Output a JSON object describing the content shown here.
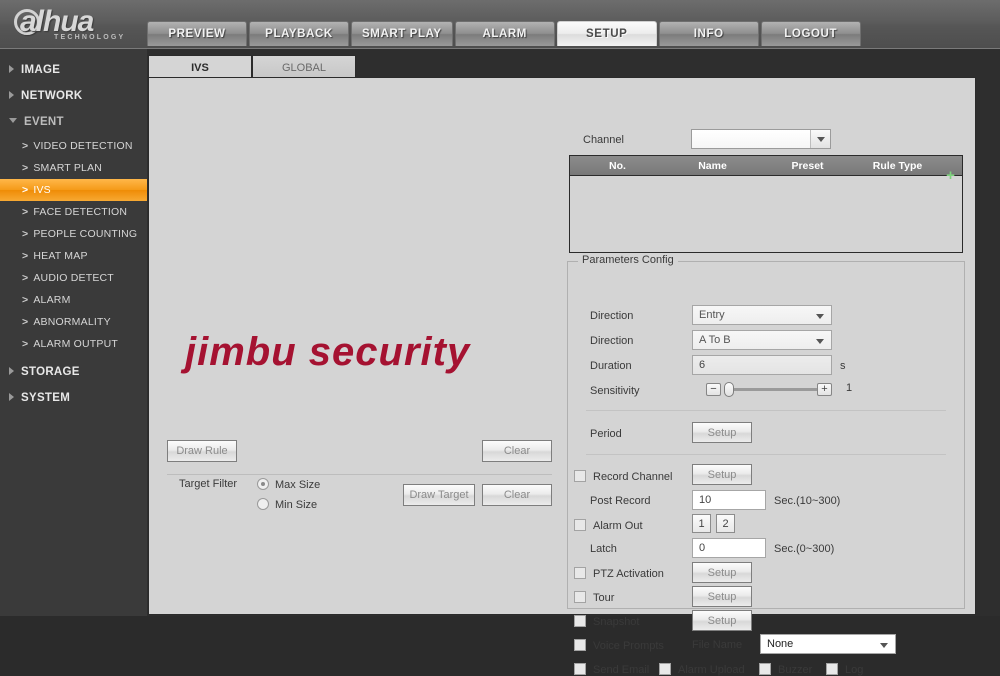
{
  "brand": {
    "name": "alhua",
    "tagline": "TECHNOLOGY"
  },
  "topnav": [
    {
      "label": "PREVIEW",
      "active": false
    },
    {
      "label": "PLAYBACK",
      "active": false
    },
    {
      "label": "SMART PLAY",
      "active": false
    },
    {
      "label": "ALARM",
      "active": false
    },
    {
      "label": "SETUP",
      "active": true
    },
    {
      "label": "INFO",
      "active": false
    },
    {
      "label": "LOGOUT",
      "active": false
    }
  ],
  "sidebar": {
    "items": [
      {
        "label": "IMAGE"
      },
      {
        "label": "NETWORK"
      },
      {
        "label": "EVENT"
      }
    ],
    "event_children": [
      {
        "label": "VIDEO DETECTION"
      },
      {
        "label": "SMART PLAN"
      },
      {
        "label": "IVS"
      },
      {
        "label": "FACE DETECTION"
      },
      {
        "label": "PEOPLE COUNTING"
      },
      {
        "label": "HEAT MAP"
      },
      {
        "label": "AUDIO DETECT"
      },
      {
        "label": "ALARM"
      },
      {
        "label": "ABNORMALITY"
      },
      {
        "label": "ALARM OUTPUT"
      }
    ],
    "items_bottom": [
      {
        "label": "STORAGE"
      },
      {
        "label": "SYSTEM"
      }
    ],
    "active_item": "IVS"
  },
  "tabs": [
    {
      "label": "IVS",
      "active": true
    },
    {
      "label": "GLOBAL",
      "active": false
    }
  ],
  "preview": {
    "watermark": "jimbu security",
    "draw_rule_label": "Draw Rule",
    "clear_rule_label": "Clear",
    "target_filter_label": "Target Filter",
    "max_size_label": "Max Size",
    "min_size_label": "Min Size",
    "target_filter_selected": "Max Size",
    "draw_target_label": "Draw Target",
    "clear_target_label": "Clear"
  },
  "config": {
    "channel_label": "Channel",
    "channel_value": "",
    "table": {
      "columns": [
        "No.",
        "Name",
        "Preset",
        "Rule Type"
      ],
      "rows": [],
      "add_icon": "+"
    },
    "params_legend": "Parameters Config",
    "direction1_label": "Direction",
    "direction1_value": "Entry",
    "direction2_label": "Direction",
    "direction2_value": "A To B",
    "duration_label": "Duration",
    "duration_value": "6",
    "duration_unit": "s",
    "sensitivity_label": "Sensitivity",
    "sensitivity_value": "1",
    "sensitivity_minus": "−",
    "sensitivity_plus": "+",
    "period_label": "Period",
    "period_setup": "Setup",
    "record_channel_label": "Record Channel",
    "record_channel_setup": "Setup",
    "post_record_label": "Post Record",
    "post_record_value": "10",
    "post_record_unit": "Sec.(10~300)",
    "alarm_out_label": "Alarm Out",
    "alarm_out_btn1": "1",
    "alarm_out_btn2": "2",
    "latch_label": "Latch",
    "latch_value": "0",
    "latch_unit": "Sec.(0~300)",
    "ptz_activation_label": "PTZ Activation",
    "ptz_setup": "Setup",
    "tour_label": "Tour",
    "tour_setup": "Setup",
    "snapshot_label": "Snapshot",
    "snapshot_setup": "Setup",
    "voice_prompts_label": "Voice Prompts",
    "file_name_label": "File Name",
    "file_name_value": "None",
    "send_email_label": "Send Email",
    "alarm_upload_label": "Alarm Upload",
    "buzzer_label": "Buzzer",
    "log_label": "Log"
  },
  "colors": {
    "accent": "#f59a18",
    "header": "#565656",
    "panel": "#d4d4d4",
    "watermark": "#a51231",
    "add_icon": "#7ed37e"
  }
}
